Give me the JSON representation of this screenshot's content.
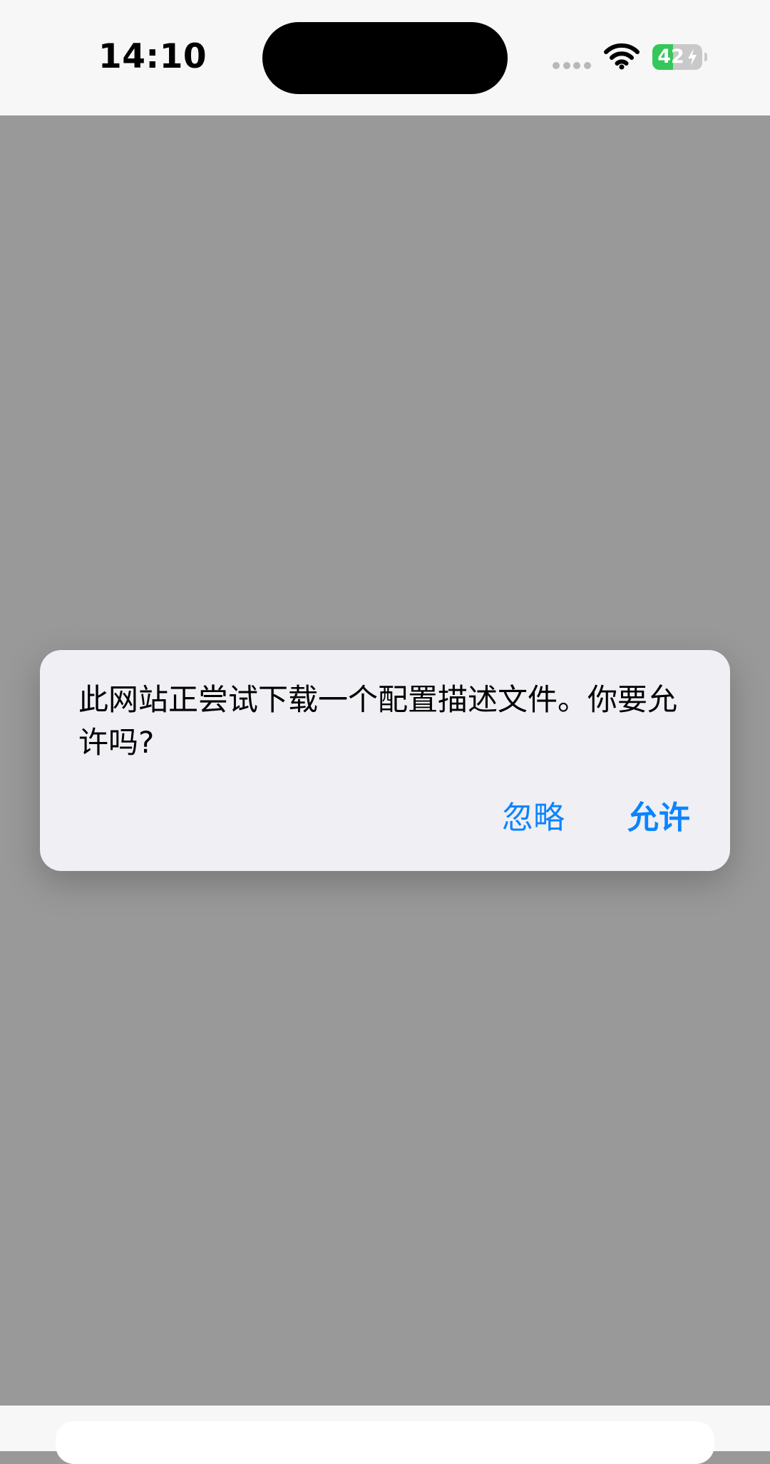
{
  "status_bar": {
    "time": "14:10",
    "battery_level": "42",
    "battery_charging": true,
    "icons": [
      "wifi-icon",
      "battery-icon",
      "cellular-signal-icon"
    ]
  },
  "alert": {
    "message": "此网站正尝试下载一个配置描述文件。你要允许吗?",
    "ignore_label": "忽略",
    "allow_label": "允许"
  },
  "colors": {
    "accent": "#0a84ff",
    "battery_green": "#34c759",
    "overlay": "#999999",
    "alert_bg": "#efeff4"
  }
}
